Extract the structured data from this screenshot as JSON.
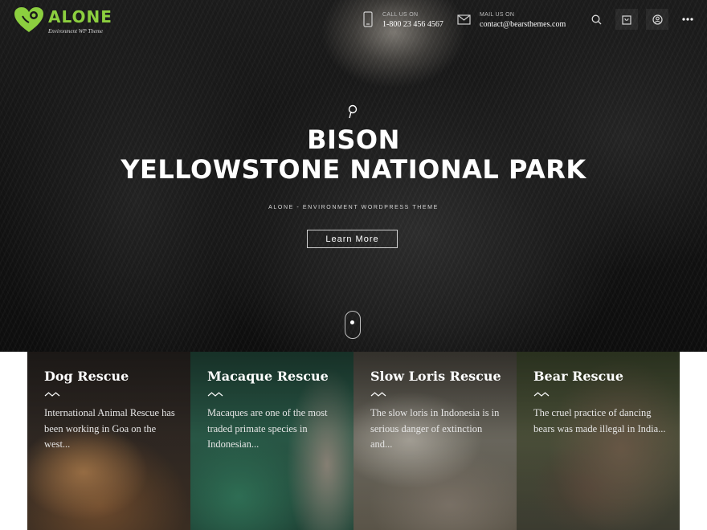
{
  "brand": {
    "name": "ALONE",
    "tagline": "Environment WP Theme",
    "color": "#8ccf3f"
  },
  "header": {
    "call": {
      "label": "CALL US ON",
      "value": "1-800 23 456 4567",
      "icon": "phone-icon"
    },
    "mail": {
      "label": "MAIL US ON",
      "value": "contact@bearsthemes.com",
      "icon": "envelope-icon"
    },
    "actions": [
      {
        "icon": "search-icon"
      },
      {
        "icon": "cart-icon"
      },
      {
        "icon": "user-icon"
      },
      {
        "icon": "more-icon"
      }
    ]
  },
  "hero": {
    "title_line1": "BISON",
    "title_line2": "YELLOWSTONE NATIONAL PARK",
    "subtitle": "ALONE - ENVIRONMENT WORDPRESS THEME",
    "button": "Learn More"
  },
  "cards": [
    {
      "title": "Dog Rescue",
      "desc": "International Animal Rescue has been working in Goa on the west..."
    },
    {
      "title": "Macaque Rescue",
      "desc": "Macaques are one of the most traded primate species in Indonesian..."
    },
    {
      "title": "Slow Loris Rescue",
      "desc": "The slow loris in Indonesia is in serious danger of extinction and..."
    },
    {
      "title": "Bear Rescue",
      "desc": "The cruel practice of dancing bears was made illegal in India..."
    }
  ]
}
